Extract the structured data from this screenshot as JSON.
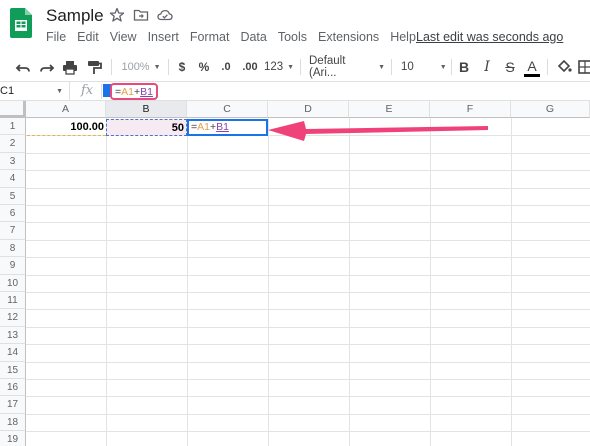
{
  "app": {
    "doc_title": "Sample",
    "menus": [
      "File",
      "Edit",
      "View",
      "Insert",
      "Format",
      "Data",
      "Tools",
      "Extensions",
      "Help"
    ],
    "last_edit": "Last edit was seconds ago"
  },
  "toolbar": {
    "zoom": "100%",
    "currency": "$",
    "percent": "%",
    "decrease_decimal": ".0",
    "increase_decimal": ".00",
    "more_formats": "123",
    "font": "Default (Ari...",
    "font_size": "10",
    "bold": "B",
    "italic": "I",
    "strikethrough": "S",
    "text_color": "A"
  },
  "formula_bar": {
    "name_box": "C1",
    "fx": "fx",
    "formula": {
      "eq": "=",
      "ref1": "A1",
      "op": "+",
      "ref2": "B1"
    }
  },
  "sheet": {
    "columns": [
      "A",
      "B",
      "C",
      "D",
      "E",
      "F",
      "G"
    ],
    "rows": [
      "1",
      "2",
      "3",
      "4",
      "5",
      "6",
      "7",
      "8",
      "9",
      "10",
      "11",
      "12",
      "13",
      "14",
      "15",
      "16",
      "17",
      "18",
      "19"
    ],
    "cells": {
      "A1": "100.00",
      "B1": "50",
      "C1": {
        "eq": "=",
        "ref1": "A1",
        "op": "+",
        "ref2": "B1"
      }
    },
    "selected_column": "B"
  },
  "colors": {
    "accent": "#1a73e8",
    "highlight_box": "#e84a7a",
    "arrow": "#f0427a",
    "ref_a1": "#e5a04c",
    "ref_b1": "#8b44ae",
    "sheets_green": "#0f9d58"
  },
  "icons": [
    "sheets-logo-icon",
    "star-icon",
    "move-to-folder-icon",
    "cloud-status-icon",
    "undo-icon",
    "redo-icon",
    "print-icon",
    "paint-format-icon",
    "fill-color-icon",
    "borders-icon"
  ]
}
